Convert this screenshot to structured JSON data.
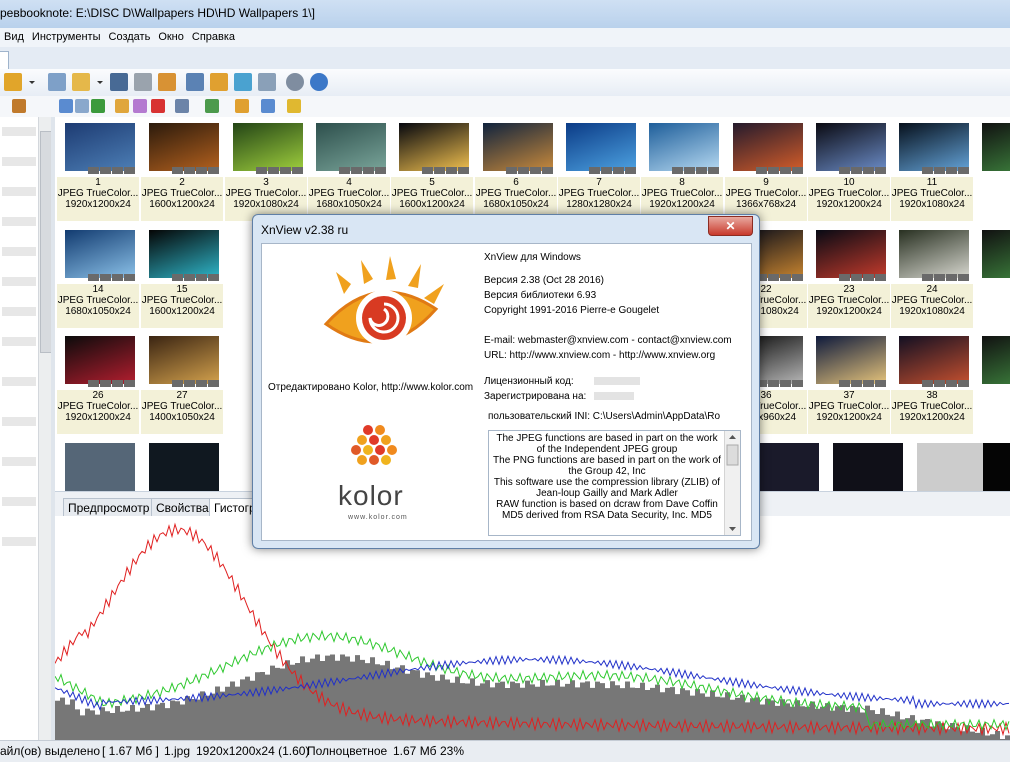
{
  "window": {
    "title": "ревbooknote: E:\\DISC D\\Wallpapers HD\\HD Wallpapers 1\\]"
  },
  "menu": [
    "Вид",
    "Инструменты",
    "Создать",
    "Окно",
    "Справка"
  ],
  "thumbnails": [
    {
      "n": "1",
      "type": "JPEG TrueColor...",
      "size": "1920x1200x24",
      "colors": [
        "#1d3b72",
        "#4d7fb6"
      ]
    },
    {
      "n": "2",
      "type": "JPEG TrueColor...",
      "size": "1600x1200x24",
      "colors": [
        "#2b1a0c",
        "#b4611e"
      ]
    },
    {
      "n": "3",
      "type": "JPEG TrueColor...",
      "size": "1920x1080x24",
      "colors": [
        "#234416",
        "#9fcf3d"
      ]
    },
    {
      "n": "4",
      "type": "JPEG TrueColor...",
      "size": "1680x1050x24",
      "colors": [
        "#2d4f4c",
        "#7aa59a"
      ]
    },
    {
      "n": "5",
      "type": "JPEG TrueColor...",
      "size": "1600x1200x24",
      "colors": [
        "#05070e",
        "#f2c14f"
      ]
    },
    {
      "n": "6",
      "type": "JPEG TrueColor...",
      "size": "1680x1050x24",
      "colors": [
        "#10233d",
        "#c98a3c"
      ]
    },
    {
      "n": "7",
      "type": "JPEG TrueColor...",
      "size": "1280x1280x24",
      "colors": [
        "#0b3b86",
        "#4da2e1"
      ]
    },
    {
      "n": "8",
      "type": "JPEG TrueColor...",
      "size": "1920x1200x24",
      "colors": [
        "#1e5e9a",
        "#b6d9f1"
      ]
    },
    {
      "n": "9",
      "type": "JPEG TrueColor...",
      "size": "1366x768x24",
      "colors": [
        "#241a2c",
        "#d45d2a"
      ]
    },
    {
      "n": "10",
      "type": "JPEG TrueColor...",
      "size": "1920x1200x24",
      "colors": [
        "#0a0a12",
        "#6b8cc7"
      ]
    },
    {
      "n": "11",
      "type": "JPEG TrueColor...",
      "size": "1920x1080x24",
      "colors": [
        "#06101c",
        "#64a3d8"
      ]
    },
    {
      "n": "14",
      "type": "JPEG TrueColor...",
      "size": "1680x1050x24",
      "colors": [
        "#123b70",
        "#8bc1e8"
      ]
    },
    {
      "n": "15",
      "type": "JPEG TrueColor...",
      "size": "1600x1200x24",
      "colors": [
        "#050505",
        "#2fb6c9"
      ]
    },
    {
      "n": "22",
      "type": "JPEG TrueColor...",
      "size": "1920x1080x24",
      "colors": [
        "#050a1a",
        "#c7842f"
      ]
    },
    {
      "n": "23",
      "type": "JPEG TrueColor...",
      "size": "1920x1200x24",
      "colors": [
        "#080a14",
        "#c43b2c"
      ]
    },
    {
      "n": "24",
      "type": "JPEG TrueColor...",
      "size": "1920x1080x24",
      "colors": [
        "#283021",
        "#d8d8d0"
      ]
    },
    {
      "n": "26",
      "type": "JPEG TrueColor...",
      "size": "1920x1200x24",
      "colors": [
        "#0b0b0b",
        "#b41e2f"
      ]
    },
    {
      "n": "27",
      "type": "JPEG TrueColor...",
      "size": "1400x1050x24",
      "colors": [
        "#3a2412",
        "#d4a24d"
      ]
    },
    {
      "n": "36",
      "type": "JPEG TrueColor...",
      "size": "1280x960x24",
      "colors": [
        "#080808",
        "#b7b7b7"
      ]
    },
    {
      "n": "37",
      "type": "JPEG TrueColor...",
      "size": "1920x1200x24",
      "colors": [
        "#0e1a3c",
        "#e6c47b"
      ]
    },
    {
      "n": "38",
      "type": "JPEG TrueColor...",
      "size": "1920x1200x24",
      "colors": [
        "#120f22",
        "#c5502f"
      ]
    }
  ],
  "badges": [
    "XMP",
    "IPTC",
    "EXIF",
    "ICC"
  ],
  "panel_tabs": [
    "Предпросмотр",
    "Свойства",
    "Гистогр"
  ],
  "status": {
    "selected": "айл(ов) выделено",
    "selsize": "[ 1.67 Мб ]",
    "file": "1.jpg",
    "dims": "1920x1200x24 (1.60)",
    "mode": "Полноцветное",
    "size": "1.67 Мб",
    "zoom": "23%"
  },
  "dialog": {
    "title": "XnView v2.38 ru",
    "close": "✕",
    "product": "XnView для Windows",
    "version": "Версия 2.38 (Oct 28 2016)",
    "libversion": "Версия библиотеки 6.93",
    "copyright": "Copyright 1991-2016 Pierre-e Gougelet",
    "email": "E-mail: webmaster@xnview.com - contact@xnview.com",
    "url": "URL: http://www.xnview.com - http://www.xnview.org",
    "license_label": "Лицензионный код:",
    "registered_label": "Зарегистрирована на:",
    "ini": "пользовательский INI: C:\\Users\\Admin\\AppData\\Ro",
    "edited_by": "Отредактировано Kolor, http://www.kolor.com",
    "kolor_word": "kolor",
    "kolor_url": "www.kolor.com",
    "credits": [
      "The JPEG functions are based in part on the work",
      "of the Independent JPEG group",
      "The PNG functions are based in part on the work of",
      "the Group 42, Inc",
      "This software use the compression library (ZLIB) of",
      "Jean-loup Gailly and Mark Adler",
      "RAW function is based on dcraw from Dave Coffin",
      "MD5 derived from RSA Data Security, Inc. MD5"
    ]
  },
  "colors": {
    "accent": "#3b6ea5",
    "histo_gray": "#777777",
    "histo_red": "#e02020",
    "histo_green": "#2ec82e",
    "histo_blue": "#2030c8"
  }
}
